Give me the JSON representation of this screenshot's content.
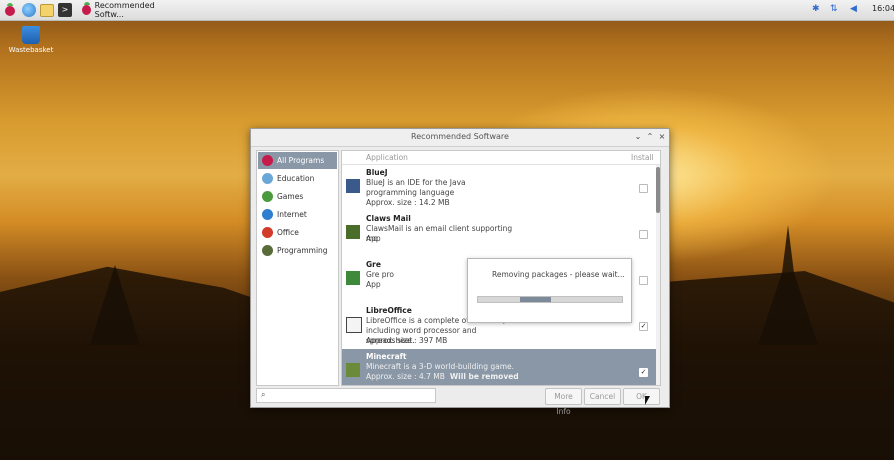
{
  "taskbar": {
    "icons": [
      "raspberry-menu-icon",
      "browser-icon",
      "file-manager-icon",
      "terminal-icon"
    ],
    "task_title": "Recommended Softw...",
    "clock": "16:04",
    "tray_icons": [
      "bluetooth-icon",
      "network-icon",
      "volume-icon"
    ]
  },
  "desktop": {
    "wastebasket_label": "Wastebasket"
  },
  "dialog": {
    "title": "Recommended Software",
    "categories": [
      {
        "label": "All Programs",
        "icon": "raspberry-icon",
        "selected": true,
        "color": "#c51a4a"
      },
      {
        "label": "Education",
        "icon": "education-icon",
        "selected": false,
        "color": "#6aa7d6"
      },
      {
        "label": "Games",
        "icon": "games-icon",
        "selected": false,
        "color": "#4c9a3e"
      },
      {
        "label": "Internet",
        "icon": "globe-icon",
        "selected": false,
        "color": "#2f7fd0"
      },
      {
        "label": "Office",
        "icon": "office-icon",
        "selected": false,
        "color": "#d23a2a"
      },
      {
        "label": "Programming",
        "icon": "programming-icon",
        "selected": false,
        "color": "#5a6b3a"
      }
    ],
    "list_header": {
      "application": "Application",
      "install": "Install"
    },
    "apps": [
      {
        "name": "BlueJ",
        "desc": "BlueJ is an IDE for the Java programming language",
        "size": "Approx. size : 14.2 MB",
        "installed": false
      },
      {
        "name": "Claws Mail",
        "desc": "ClawsMail is an email client supporting mo",
        "size": "App",
        "installed": false
      },
      {
        "name": "Gre",
        "desc": "Gre pro",
        "size": "App",
        "installed": false
      },
      {
        "name": "LibreOffice",
        "desc": "LibreOffice is a complete office suite, including word processor and spreadsheet.",
        "size": "Approx. size : 397 MB",
        "installed": true
      },
      {
        "name": "Minecraft",
        "desc": "Minecraft is a 3-D world-building game.",
        "size": "Approx. size : 4.7 MB",
        "note": "Will be removed",
        "installed": true,
        "selected": true
      }
    ],
    "progress": {
      "message": "Removing packages - please wait...",
      "indeterminate_position": 0.29,
      "indeterminate_width": 0.22
    },
    "search": {
      "placeholder": ""
    },
    "buttons": {
      "more_info": "More Info",
      "cancel": "Cancel",
      "ok": "OK"
    },
    "colors": {
      "selection": "#8a97a6"
    }
  }
}
